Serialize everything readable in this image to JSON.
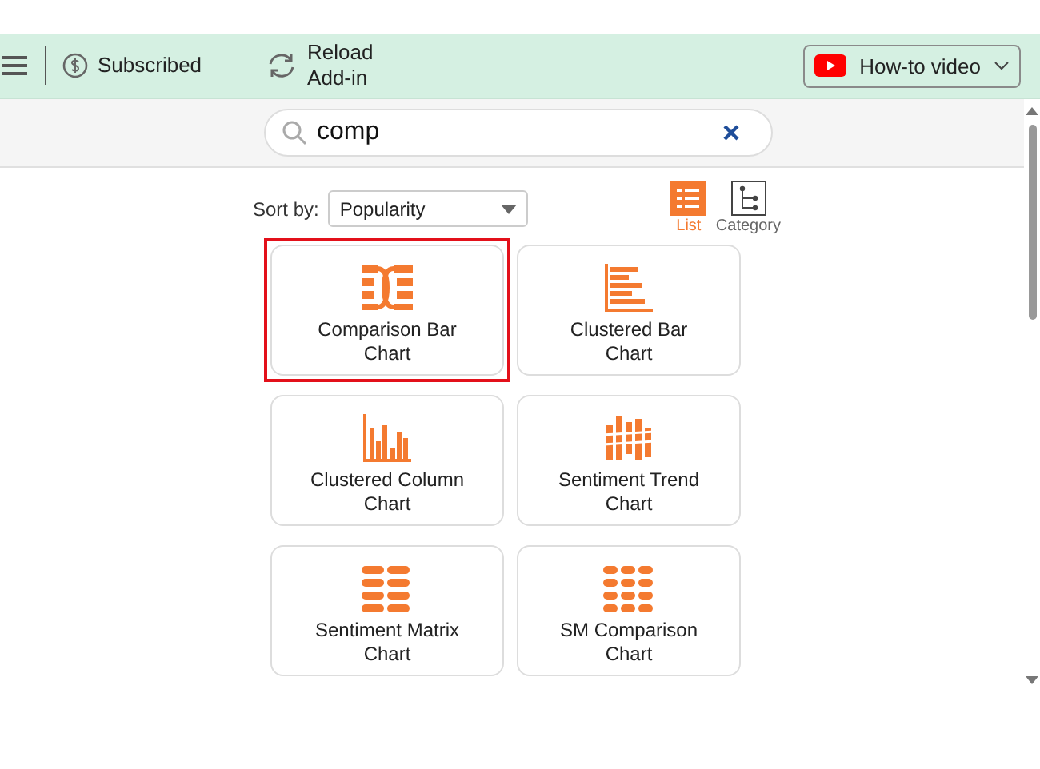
{
  "toolbar": {
    "subscription": "Subscribed",
    "reload": "Reload\nAdd-in",
    "video_button": "How-to video"
  },
  "search": {
    "value": "comp"
  },
  "sort": {
    "label": "Sort by:",
    "value": "Popularity"
  },
  "views": [
    {
      "label": "List",
      "kind": "list",
      "selected": true
    },
    {
      "label": "Category",
      "kind": "tree",
      "selected": false
    }
  ],
  "charts": [
    {
      "label": "Comparison Bar Chart",
      "kind": "comparison",
      "selected": true
    },
    {
      "label": "Clustered Bar Chart",
      "kind": "bars",
      "selected": false
    },
    {
      "label": "Clustered Column Chart",
      "kind": "columns",
      "selected": false
    },
    {
      "label": "Sentiment Trend Chart",
      "kind": "trend",
      "selected": false
    },
    {
      "label": "Sentiment Matrix Chart",
      "kind": "matrix2",
      "selected": false
    },
    {
      "label": "SM Comparison Chart",
      "kind": "matrix3",
      "selected": false
    }
  ]
}
